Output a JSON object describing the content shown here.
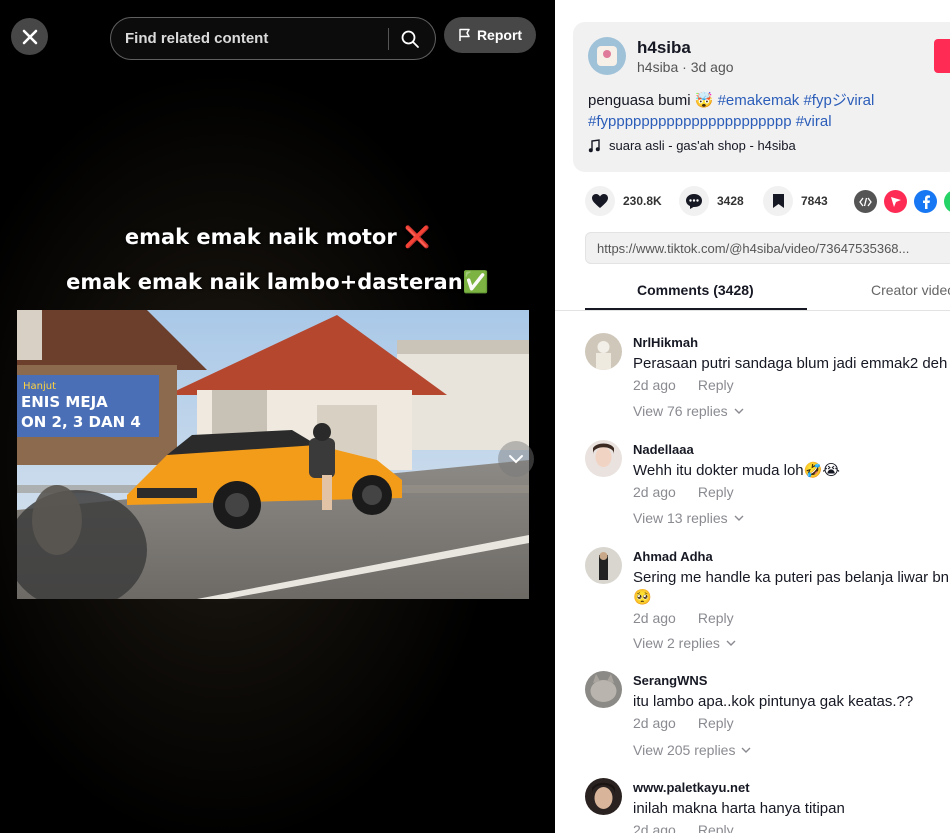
{
  "video": {
    "close_icon": "close-icon",
    "search": {
      "placeholder": "Find related content"
    },
    "report_label": "Report",
    "caption_line1": "emak emak naik motor ❌",
    "caption_line2": "emak emak naik lambo+dasteran✅",
    "storefront_sign_line1": "ENIS MEJA",
    "storefront_sign_line2": "ON 2, 3 DAN 4",
    "storefront_sign_top": "Hanjut"
  },
  "post": {
    "author": "h4siba",
    "author_meta": "h4siba · 3d ago",
    "desc_text": "penguasa bumi 🤯 ",
    "hashtags": [
      "#emakemak",
      "#fypジviral",
      "#fypppppppppppppppppppppp",
      "#viral"
    ],
    "music": "suara asli - gas'ah shop - h4siba",
    "accent_color": "#fe2c55",
    "hashtag_color": "#2b5db9"
  },
  "actions": {
    "likes": "230.8K",
    "comments": "3428",
    "saves": "7843"
  },
  "link": "https://www.tiktok.com/@h4siba/video/73647535368...",
  "tabs": {
    "comments": "Comments (3428)",
    "creator": "Creator videos"
  },
  "comments": [
    {
      "user": "NrlHikmah",
      "text": "Perasaan putri sandaga blum jadi emmak2 deh",
      "date": "2d ago",
      "reply": "Reply",
      "view": "View 76 replies"
    },
    {
      "user": "Nadellaaa",
      "text": "Wehh itu dokter muda loh🤣😭",
      "date": "2d ago",
      "reply": "Reply",
      "view": "View 13 replies"
    },
    {
      "user": "Ahmad Adha",
      "text": "Sering me handle ka puteri pas belanja liwar bnr🥺",
      "date": "2d ago",
      "reply": "Reply",
      "view": "View 2 replies"
    },
    {
      "user": "SerangWNS",
      "text": "itu lambo apa..kok pintunya gak keatas.??",
      "date": "2d ago",
      "reply": "Reply",
      "view": "View 205 replies"
    },
    {
      "user": "www.paletkayu.net",
      "text": "inilah makna harta hanya titipan",
      "date": "2d ago",
      "reply": "Reply"
    }
  ]
}
